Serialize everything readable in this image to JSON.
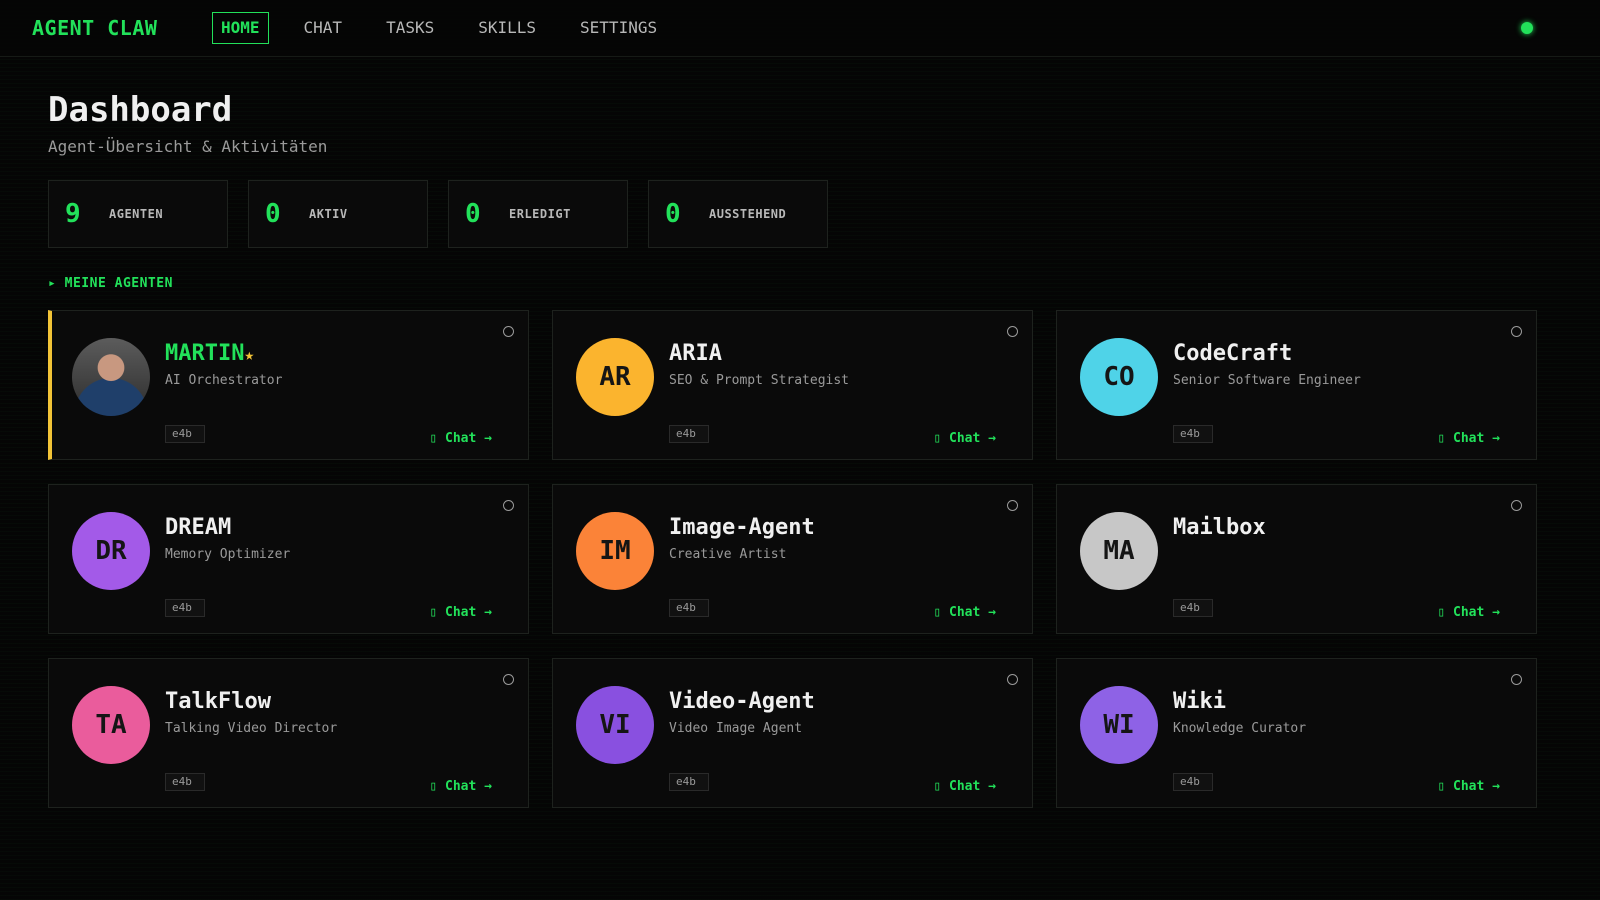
{
  "app": {
    "brand": "AGENT CLAW"
  },
  "nav": {
    "items": [
      {
        "label": "HOME",
        "active": true
      },
      {
        "label": "CHAT"
      },
      {
        "label": "TASKS"
      },
      {
        "label": "SKILLS"
      },
      {
        "label": "SETTINGS"
      }
    ]
  },
  "header": {
    "title": "Dashboard",
    "subtitle": "Agent-Übersicht & Aktivitäten"
  },
  "stats": [
    {
      "value": "9",
      "label": "AGENTEN"
    },
    {
      "value": "0",
      "label": "AKTIV"
    },
    {
      "value": "0",
      "label": "ERLEDIGT"
    },
    {
      "value": "0",
      "label": "AUSSTEHEND"
    }
  ],
  "section": {
    "title": "▸ MEINE AGENTEN"
  },
  "colors": {
    "accent": "#22e15a",
    "featured": "#f2c437"
  },
  "agents": [
    {
      "initials": "",
      "name": "MARTIN",
      "star": "★",
      "role": "AI Orchestrator",
      "model": "e4b",
      "chat": "▯ Chat →",
      "color": "photo",
      "featured": true
    },
    {
      "initials": "AR",
      "name": "ARIA",
      "role": "SEO & Prompt Strategist",
      "model": "e4b",
      "chat": "▯ Chat →",
      "color": "#fbb42e"
    },
    {
      "initials": "CO",
      "name": "CodeCraft",
      "role": "Senior Software Engineer",
      "model": "e4b",
      "chat": "▯ Chat →",
      "color": "#4fd3e8"
    },
    {
      "initials": "DR",
      "name": "DREAM",
      "role": "Memory Optimizer",
      "model": "e4b",
      "chat": "▯ Chat →",
      "color": "#a35ae8"
    },
    {
      "initials": "IM",
      "name": "Image-Agent",
      "role": "Creative Artist",
      "model": "e4b",
      "chat": "▯ Chat →",
      "color": "#fb8338"
    },
    {
      "initials": "MA",
      "name": "Mailbox",
      "role": "",
      "model": "e4b",
      "chat": "▯ Chat →",
      "color": "#c7c7c7"
    },
    {
      "initials": "TA",
      "name": "TalkFlow",
      "role": "Talking Video Director",
      "model": "e4b",
      "chat": "▯ Chat →",
      "color": "#ea5c9c"
    },
    {
      "initials": "VI",
      "name": "Video-Agent",
      "role": "Video Image Agent",
      "model": "e4b",
      "chat": "▯ Chat →",
      "color": "#8950e0"
    },
    {
      "initials": "WI",
      "name": "Wiki",
      "role": "Knowledge Curator",
      "model": "e4b",
      "chat": "▯ Chat →",
      "color": "#8e62e6"
    }
  ]
}
